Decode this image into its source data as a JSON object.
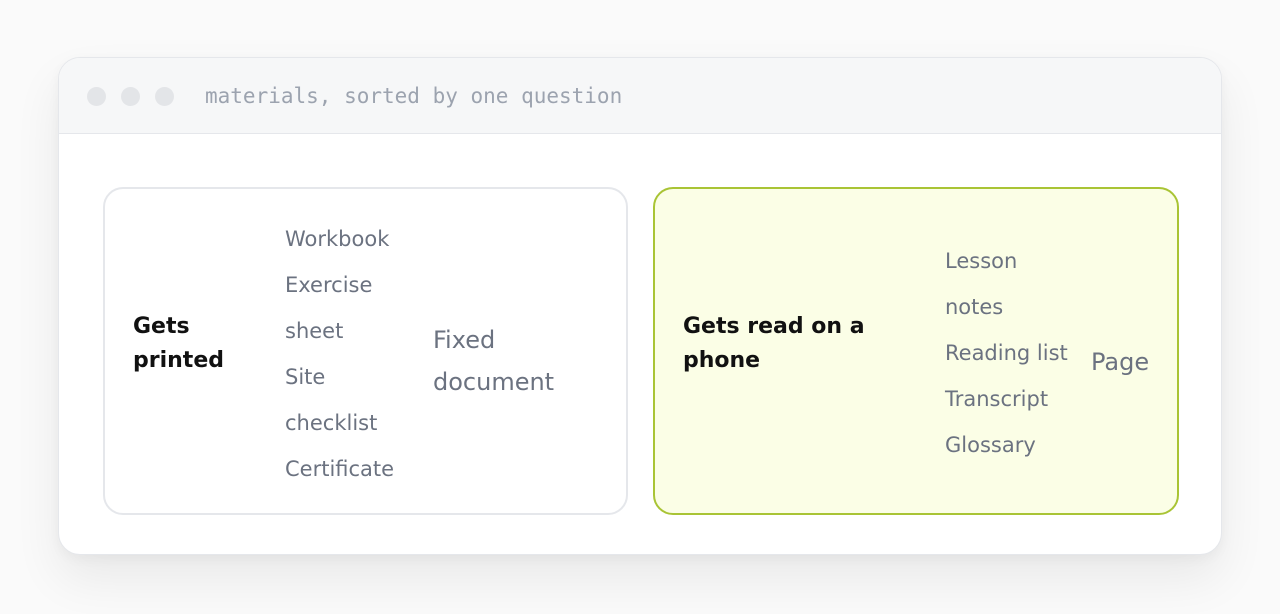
{
  "window": {
    "title": "materials, sorted by one question"
  },
  "groups": [
    {
      "condition_lines": [
        "Gets",
        "printed"
      ],
      "item_lines": [
        "Workbook",
        "Exercise",
        "sheet",
        "Site",
        "checklist",
        "Certificate"
      ],
      "result_lines": [
        "Fixed",
        "document"
      ],
      "highlighted": false
    },
    {
      "condition_lines": [
        "Gets read on a",
        "phone"
      ],
      "item_lines": [
        "Lesson",
        "notes",
        "Reading list",
        "Transcript",
        "Glossary"
      ],
      "result_lines": [
        "Page"
      ],
      "highlighted": true
    }
  ],
  "colors": {
    "highlight_border": "#a9c435",
    "highlight_fill": "#fbfee6",
    "muted_text": "#6b7280",
    "strong_text": "#111111"
  }
}
